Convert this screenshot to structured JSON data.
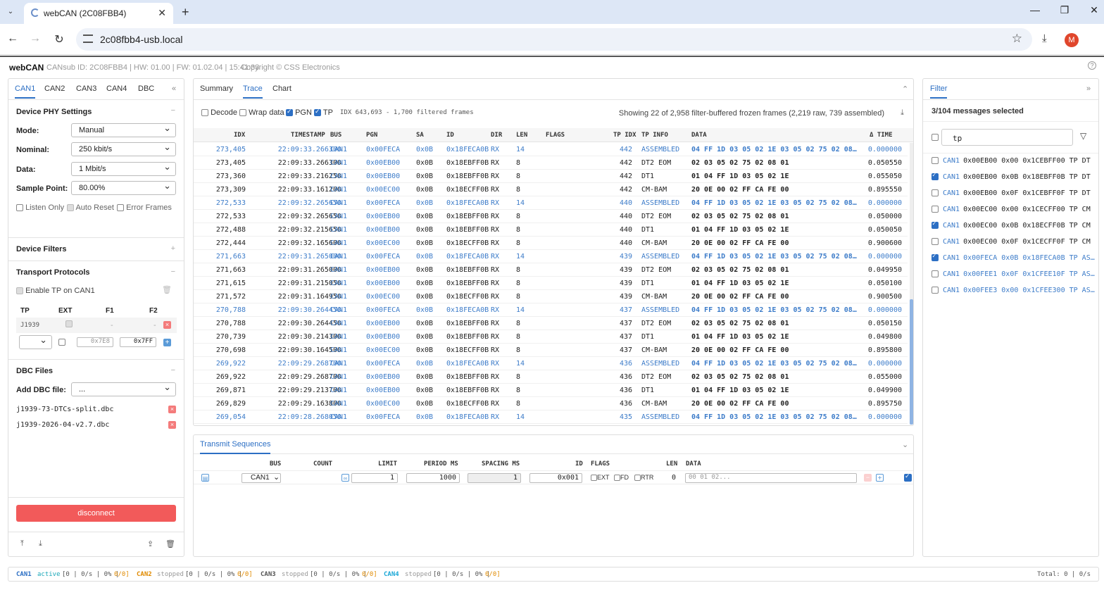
{
  "browser": {
    "tab_title": "webCAN (2C08FBB4)",
    "url": "2c08fbb4-usb.local",
    "avatar_letter": "M"
  },
  "app": {
    "brand": "webCAN",
    "device_info": "CANsub ID: 2C08FBB4 | HW: 01.00 | FW: 01.02.04 | 15:41:33",
    "copyright": "Copyright © CSS Electronics"
  },
  "left": {
    "tabs": [
      "CAN1",
      "CAN2",
      "CAN3",
      "CAN4",
      "DBC"
    ],
    "phy": {
      "title": "Device PHY Settings",
      "mode_label": "Mode:",
      "mode_value": "Manual",
      "nominal_label": "Nominal:",
      "nominal_value": "250 kbit/s",
      "data_label": "Data:",
      "data_value": "1 Mbit/s",
      "sample_label": "Sample Point:",
      "sample_value": "80.00%",
      "listen_only": "Listen Only",
      "auto_reset": "Auto Reset",
      "error_frames": "Error Frames"
    },
    "filters_title": "Device Filters",
    "tp": {
      "title": "Transport Protocols",
      "enable_label": "Enable TP on CAN1",
      "col_tp": "TP",
      "col_ext": "EXT",
      "col_f1": "F1",
      "col_f2": "F2",
      "row1_tp": "J1939",
      "row1_f1": "-",
      "row1_f2": "-",
      "f1_placeholder": "0x7E8",
      "f2_placeholder": "0x7FF"
    },
    "dbc": {
      "title": "DBC Files",
      "add_label": "Add DBC file:",
      "add_value": "...",
      "files": [
        "j1939-73-DTCs-split.dbc",
        "j1939-2026-04-v2.7.dbc"
      ]
    },
    "disconnect_label": "disconnect"
  },
  "trace": {
    "tabs": [
      "Summary",
      "Trace",
      "Chart"
    ],
    "decode": "Decode",
    "wrap": "Wrap data",
    "pgn": "PGN",
    "tp": "TP",
    "idx_info": "IDX 643,693 - 1,700 filtered frames",
    "showing": "Showing 22 of 2,958 filter-buffered frozen frames (2,219 raw, 739 assembled)",
    "columns": [
      "IDX",
      "TIMESTAMP",
      "BUS",
      "PGN",
      "SA",
      "ID",
      "DIR",
      "LEN",
      "FLAGS",
      "TP IDX",
      "TP INFO",
      "DATA",
      "Δ TIME"
    ],
    "rows": [
      {
        "idx": "273,405",
        "ts": "22:09:33.266300",
        "bus": "CAN1",
        "pgn": "0x00FECA",
        "sa": "0x0B",
        "id": "0x18FECA0B",
        "dir": "RX",
        "len": "14",
        "tpidx": "442",
        "tpinfo": "ASSEMBLED",
        "data": "04 FF 1D 03 05 02 1E 03 05 02 75 02 08…",
        "dt": "0.000000",
        "asm": true
      },
      {
        "idx": "273,405",
        "ts": "22:09:33.266300",
        "bus": "CAN1",
        "pgn": "0x00EB00",
        "sa": "0x0B",
        "id": "0x18EBFF0B",
        "dir": "RX",
        "len": "8",
        "tpidx": "442",
        "tpinfo": "DT2 EOM",
        "data": "02 03 05 02 75 02 08 01",
        "dt": "0.050550",
        "asm": false
      },
      {
        "idx": "273,360",
        "ts": "22:09:33.216250",
        "bus": "CAN1",
        "pgn": "0x00EB00",
        "sa": "0x0B",
        "id": "0x18EBFF0B",
        "dir": "RX",
        "len": "8",
        "tpidx": "442",
        "tpinfo": "DT1",
        "data": "01 04 FF 1D 03 05 02 1E",
        "dt": "0.055050",
        "asm": false
      },
      {
        "idx": "273,309",
        "ts": "22:09:33.161200",
        "bus": "CAN1",
        "pgn": "0x00EC00",
        "sa": "0x0B",
        "id": "0x18ECFF0B",
        "dir": "RX",
        "len": "8",
        "tpidx": "442",
        "tpinfo": "CM-BAM",
        "data": "20 0E 00 02 FF CA FE 00",
        "dt": "0.895550",
        "asm": false
      },
      {
        "idx": "272,533",
        "ts": "22:09:32.265650",
        "bus": "CAN1",
        "pgn": "0x00FECA",
        "sa": "0x0B",
        "id": "0x18FECA0B",
        "dir": "RX",
        "len": "14",
        "tpidx": "440",
        "tpinfo": "ASSEMBLED",
        "data": "04 FF 1D 03 05 02 1E 03 05 02 75 02 08…",
        "dt": "0.000000",
        "asm": true
      },
      {
        "idx": "272,533",
        "ts": "22:09:32.265650",
        "bus": "CAN1",
        "pgn": "0x00EB00",
        "sa": "0x0B",
        "id": "0x18EBFF0B",
        "dir": "RX",
        "len": "8",
        "tpidx": "440",
        "tpinfo": "DT2 EOM",
        "data": "02 03 05 02 75 02 08 01",
        "dt": "0.050000",
        "asm": false
      },
      {
        "idx": "272,488",
        "ts": "22:09:32.215650",
        "bus": "CAN1",
        "pgn": "0x00EB00",
        "sa": "0x0B",
        "id": "0x18EBFF0B",
        "dir": "RX",
        "len": "8",
        "tpidx": "440",
        "tpinfo": "DT1",
        "data": "01 04 FF 1D 03 05 02 1E",
        "dt": "0.050050",
        "asm": false
      },
      {
        "idx": "272,444",
        "ts": "22:09:32.165600",
        "bus": "CAN1",
        "pgn": "0x00EC00",
        "sa": "0x0B",
        "id": "0x18ECFF0B",
        "dir": "RX",
        "len": "8",
        "tpidx": "440",
        "tpinfo": "CM-BAM",
        "data": "20 0E 00 02 FF CA FE 00",
        "dt": "0.900600",
        "asm": false
      },
      {
        "idx": "271,663",
        "ts": "22:09:31.265000",
        "bus": "CAN1",
        "pgn": "0x00FECA",
        "sa": "0x0B",
        "id": "0x18FECA0B",
        "dir": "RX",
        "len": "14",
        "tpidx": "439",
        "tpinfo": "ASSEMBLED",
        "data": "04 FF 1D 03 05 02 1E 03 05 02 75 02 08…",
        "dt": "0.000000",
        "asm": true
      },
      {
        "idx": "271,663",
        "ts": "22:09:31.265000",
        "bus": "CAN1",
        "pgn": "0x00EB00",
        "sa": "0x0B",
        "id": "0x18EBFF0B",
        "dir": "RX",
        "len": "8",
        "tpidx": "439",
        "tpinfo": "DT2 EOM",
        "data": "02 03 05 02 75 02 08 01",
        "dt": "0.049950",
        "asm": false
      },
      {
        "idx": "271,615",
        "ts": "22:09:31.215050",
        "bus": "CAN1",
        "pgn": "0x00EB00",
        "sa": "0x0B",
        "id": "0x18EBFF0B",
        "dir": "RX",
        "len": "8",
        "tpidx": "439",
        "tpinfo": "DT1",
        "data": "01 04 FF 1D 03 05 02 1E",
        "dt": "0.050100",
        "asm": false
      },
      {
        "idx": "271,572",
        "ts": "22:09:31.164950",
        "bus": "CAN1",
        "pgn": "0x00EC00",
        "sa": "0x0B",
        "id": "0x18ECFF0B",
        "dir": "RX",
        "len": "8",
        "tpidx": "439",
        "tpinfo": "CM-BAM",
        "data": "20 0E 00 02 FF CA FE 00",
        "dt": "0.900500",
        "asm": false
      },
      {
        "idx": "270,788",
        "ts": "22:09:30.264450",
        "bus": "CAN1",
        "pgn": "0x00FECA",
        "sa": "0x0B",
        "id": "0x18FECA0B",
        "dir": "RX",
        "len": "14",
        "tpidx": "437",
        "tpinfo": "ASSEMBLED",
        "data": "04 FF 1D 03 05 02 1E 03 05 02 75 02 08…",
        "dt": "0.000000",
        "asm": true
      },
      {
        "idx": "270,788",
        "ts": "22:09:30.264450",
        "bus": "CAN1",
        "pgn": "0x00EB00",
        "sa": "0x0B",
        "id": "0x18EBFF0B",
        "dir": "RX",
        "len": "8",
        "tpidx": "437",
        "tpinfo": "DT2 EOM",
        "data": "02 03 05 02 75 02 08 01",
        "dt": "0.050150",
        "asm": false
      },
      {
        "idx": "270,739",
        "ts": "22:09:30.214300",
        "bus": "CAN1",
        "pgn": "0x00EB00",
        "sa": "0x0B",
        "id": "0x18EBFF0B",
        "dir": "RX",
        "len": "8",
        "tpidx": "437",
        "tpinfo": "DT1",
        "data": "01 04 FF 1D 03 05 02 1E",
        "dt": "0.049800",
        "asm": false
      },
      {
        "idx": "270,698",
        "ts": "22:09:30.164500",
        "bus": "CAN1",
        "pgn": "0x00EC00",
        "sa": "0x0B",
        "id": "0x18ECFF0B",
        "dir": "RX",
        "len": "8",
        "tpidx": "437",
        "tpinfo": "CM-BAM",
        "data": "20 0E 00 02 FF CA FE 00",
        "dt": "0.895800",
        "asm": false
      },
      {
        "idx": "269,922",
        "ts": "22:09:29.268700",
        "bus": "CAN1",
        "pgn": "0x00FECA",
        "sa": "0x0B",
        "id": "0x18FECA0B",
        "dir": "RX",
        "len": "14",
        "tpidx": "436",
        "tpinfo": "ASSEMBLED",
        "data": "04 FF 1D 03 05 02 1E 03 05 02 75 02 08…",
        "dt": "0.000000",
        "asm": true
      },
      {
        "idx": "269,922",
        "ts": "22:09:29.268700",
        "bus": "CAN1",
        "pgn": "0x00EB00",
        "sa": "0x0B",
        "id": "0x18EBFF0B",
        "dir": "RX",
        "len": "8",
        "tpidx": "436",
        "tpinfo": "DT2 EOM",
        "data": "02 03 05 02 75 02 08 01",
        "dt": "0.055000",
        "asm": false
      },
      {
        "idx": "269,871",
        "ts": "22:09:29.213700",
        "bus": "CAN1",
        "pgn": "0x00EB00",
        "sa": "0x0B",
        "id": "0x18EBFF0B",
        "dir": "RX",
        "len": "8",
        "tpidx": "436",
        "tpinfo": "DT1",
        "data": "01 04 FF 1D 03 05 02 1E",
        "dt": "0.049900",
        "asm": false
      },
      {
        "idx": "269,829",
        "ts": "22:09:29.163800",
        "bus": "CAN1",
        "pgn": "0x00EC00",
        "sa": "0x0B",
        "id": "0x18ECFF0B",
        "dir": "RX",
        "len": "8",
        "tpidx": "436",
        "tpinfo": "CM-BAM",
        "data": "20 0E 00 02 FF CA FE 00",
        "dt": "0.895750",
        "asm": false
      },
      {
        "idx": "269,054",
        "ts": "22:09:28.268050",
        "bus": "CAN1",
        "pgn": "0x00FECA",
        "sa": "0x0B",
        "id": "0x18FECA0B",
        "dir": "RX",
        "len": "14",
        "tpidx": "435",
        "tpinfo": "ASSEMBLED",
        "data": "04 FF 1D 03 05 02 1E 03 05 02 75 02 08…",
        "dt": "0.000000",
        "asm": true
      }
    ]
  },
  "transmit": {
    "title": "Transmit Sequences",
    "columns": [
      "BUS",
      "COUNT",
      "LIMIT",
      "PERIOD MS",
      "SPACING MS",
      "ID",
      "FLAGS",
      "LEN",
      "DATA"
    ],
    "bus": "CAN1",
    "infinity": "∞",
    "limit": "1",
    "period": "1000",
    "spacing": "1",
    "id": "0x001",
    "ext": "EXT",
    "fd": "FD",
    "rtr": "RTR",
    "len": "0",
    "data_placeholder": "00 01 02..."
  },
  "filter": {
    "tab": "Filter",
    "selected": "3/104 messages selected",
    "search": "tp",
    "items": [
      {
        "bus": "CAN1",
        "text": "0x00EB00 0x00 0x1CEBFF00 TP DT",
        "checked": false
      },
      {
        "bus": "CAN1",
        "text": "0x00EB00 0x0B 0x18EBFF0B TP DT",
        "checked": true
      },
      {
        "bus": "CAN1",
        "text": "0x00EB00 0x0F 0x1CEBFF0F TP DT",
        "checked": false
      },
      {
        "bus": "CAN1",
        "text": "0x00EC00 0x00 0x1CECFF00 TP CM",
        "checked": false
      },
      {
        "bus": "CAN1",
        "text": "0x00EC00 0x0B 0x18ECFF0B TP CM",
        "checked": true
      },
      {
        "bus": "CAN1",
        "text": "0x00EC00 0x0F 0x1CECFF0F TP CM",
        "checked": false
      },
      {
        "bus": "CAN1",
        "text": "0x00FECA 0x0B 0x18FECA0B TP AS…",
        "checked": true,
        "blue": true
      },
      {
        "bus": "CAN1",
        "text": "0x00FEE1 0x0F 0x1CFEE10F TP AS…",
        "checked": false,
        "blue": true
      },
      {
        "bus": "CAN1",
        "text": "0x00FEE3 0x00 0x1CFEE300 TP AS…",
        "checked": false,
        "blue": true
      }
    ]
  },
  "status": {
    "can1": "CAN1",
    "can1_state": "active",
    "can1_stats": "[0 | 0/s | 0% |",
    "can1_err": "0/0]",
    "can2": "CAN2",
    "can2_state": "stopped",
    "can2_stats": "[0 | 0/s | 0% |",
    "can2_err": "0/0]",
    "can3": "CAN3",
    "can3_state": "stopped",
    "can3_stats": "[0 | 0/s | 0% |",
    "can3_err": "0/0]",
    "can4": "CAN4",
    "can4_state": "stopped",
    "can4_stats": "[0 | 0/s | 0% |",
    "can4_err": "0/0]",
    "total": "Total: 0 | 0/s"
  },
  "colors": {
    "accent": "#2c6fc4",
    "assembled": "#3d7cc9",
    "disconnect": "#f25a5a",
    "can1_active": "#1aa7b8",
    "can2_orange": "#e08a00",
    "can4_blue": "#1aa7d6"
  }
}
